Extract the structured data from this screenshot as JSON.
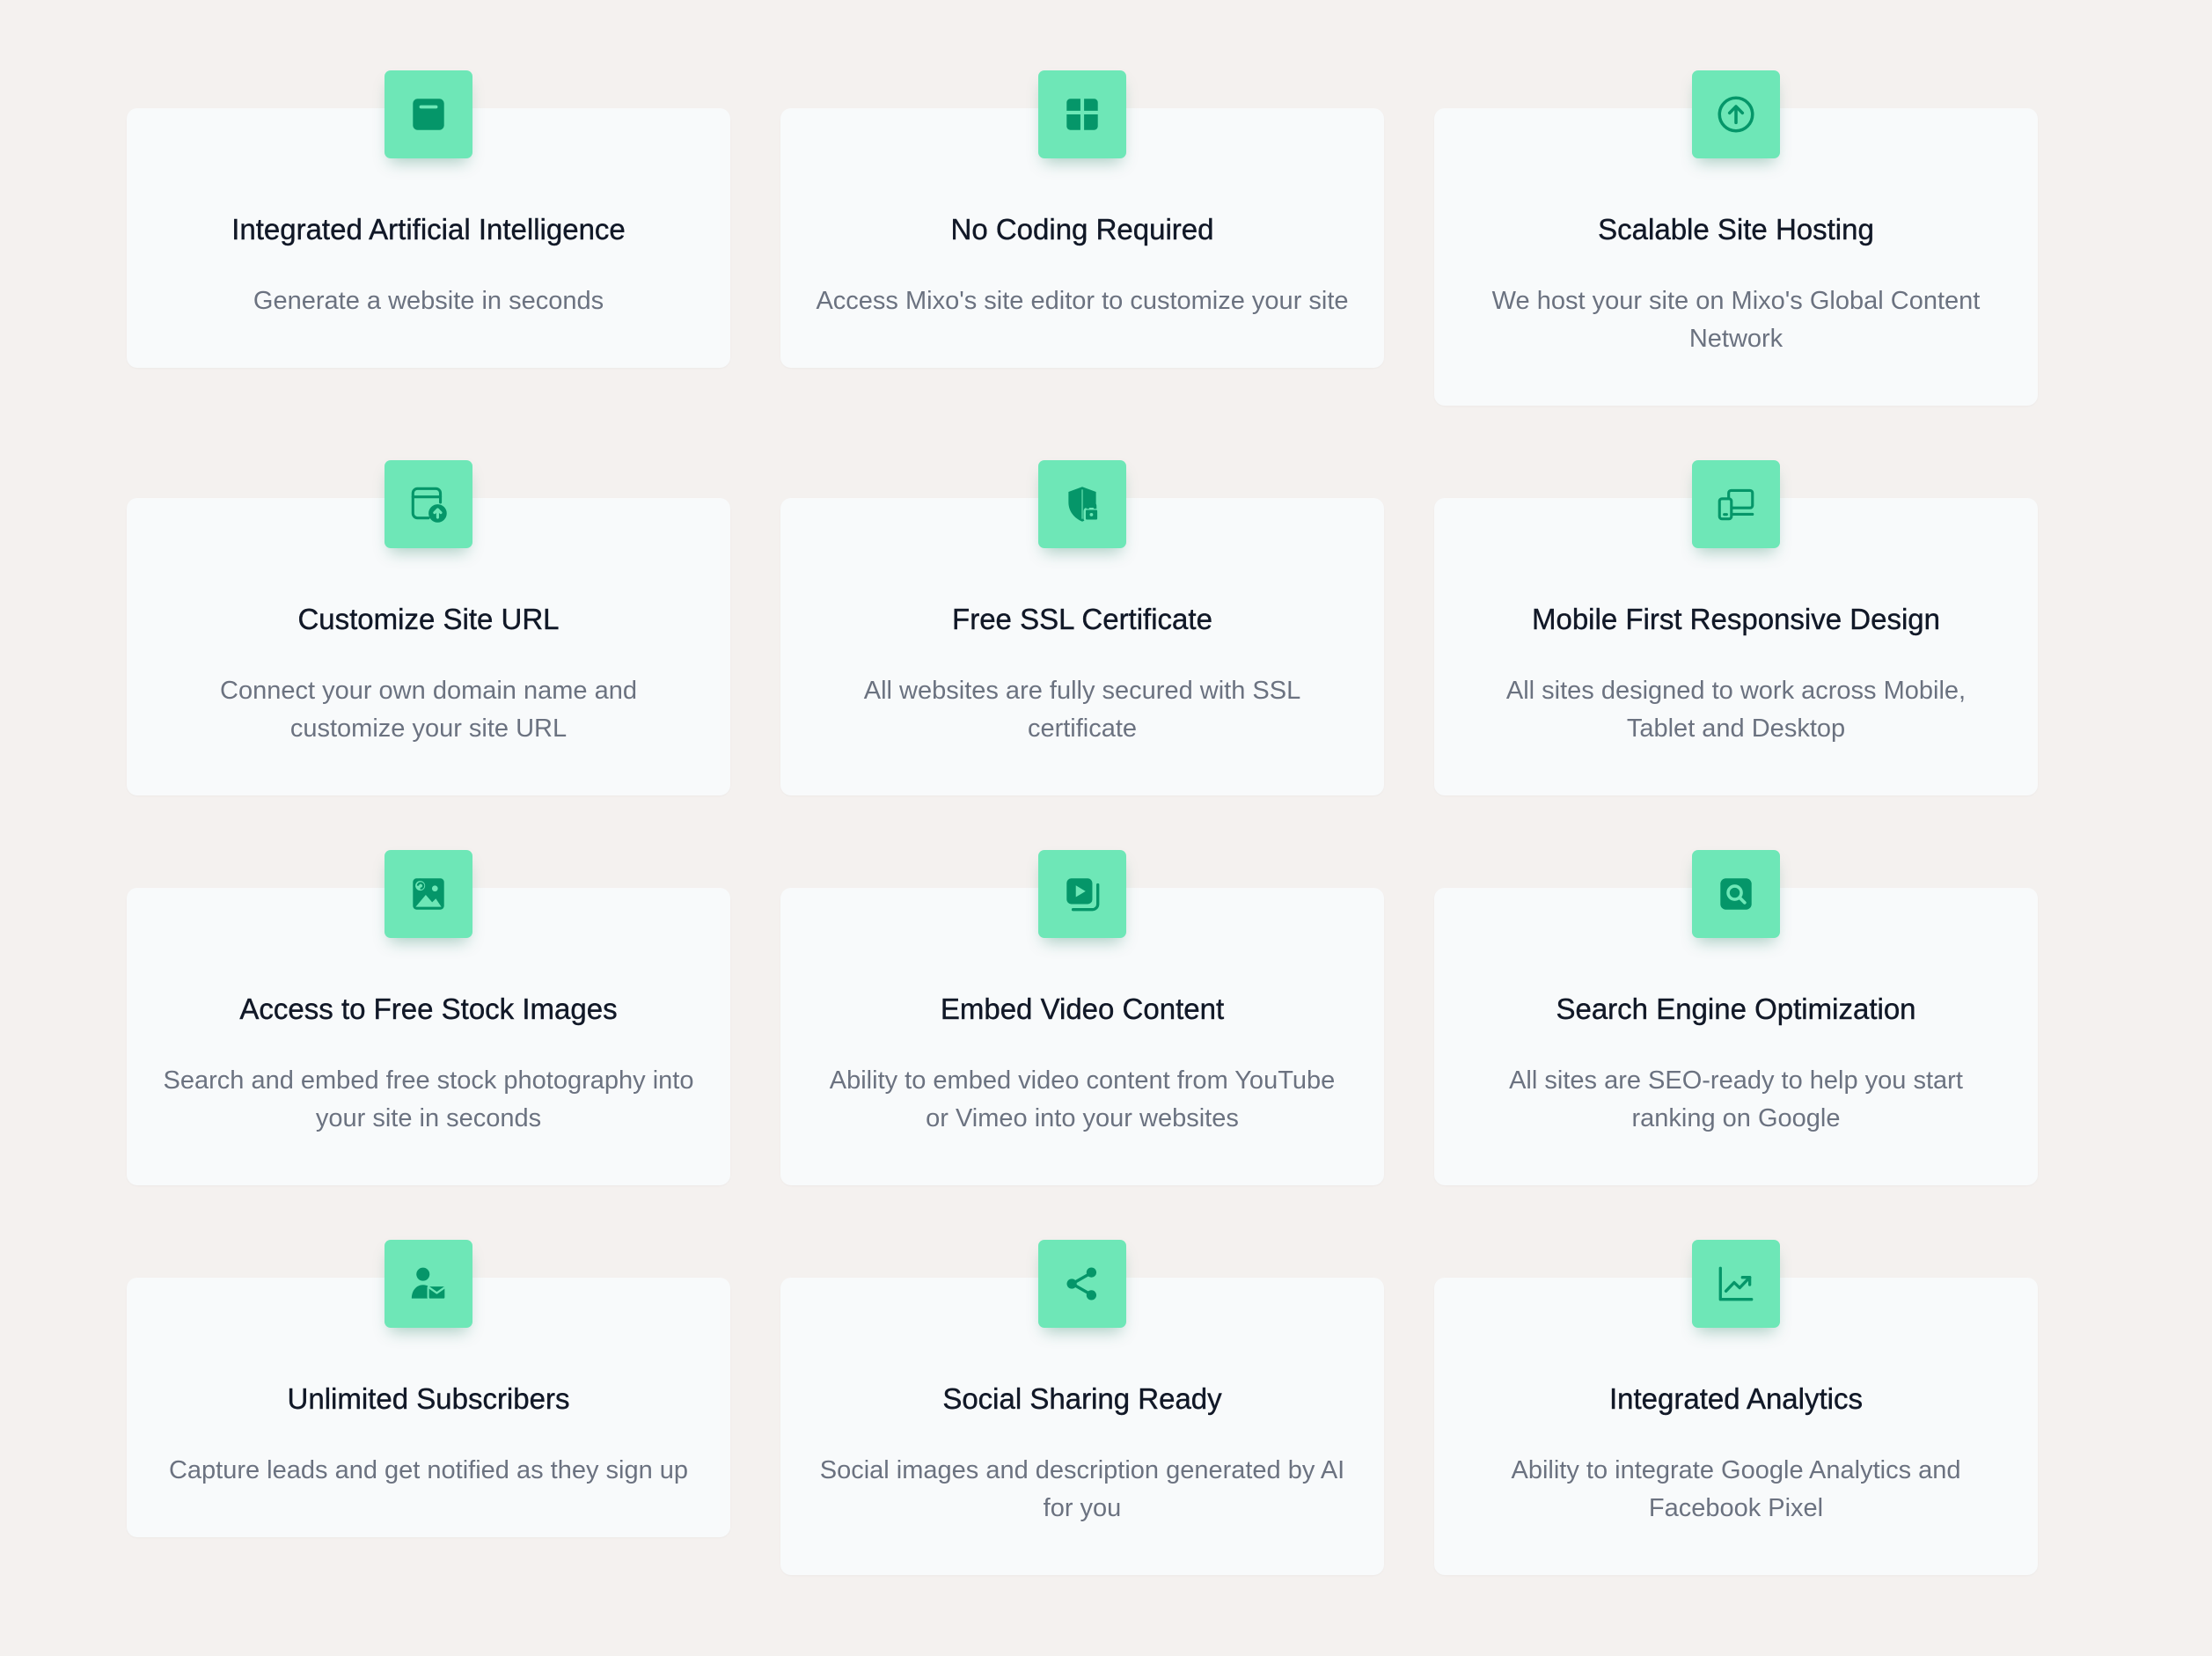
{
  "colors": {
    "page_background": "#f4f1ef",
    "card_background": "#f8fafb",
    "icon_badge": "#6ee7b7",
    "icon_foreground": "#059669",
    "title_text": "#111827",
    "description_text": "#6b7280"
  },
  "features": [
    {
      "icon": "browser-window-icon",
      "title": "Integrated Artificial Intelligence",
      "description": "Generate a website in seconds"
    },
    {
      "icon": "layout-grid-icon",
      "title": "No Coding Required",
      "description": "Access Mixo's site editor to customize your site"
    },
    {
      "icon": "arrow-up-circle-icon",
      "title": "Scalable Site Hosting",
      "description": "We host your site on Mixo's Global Content Network"
    },
    {
      "icon": "browser-upload-icon",
      "title": "Customize Site URL",
      "description": "Connect your own domain name and customize your site URL"
    },
    {
      "icon": "shield-lock-icon",
      "title": "Free SSL Certificate",
      "description": "All websites are fully secured with SSL certificate"
    },
    {
      "icon": "devices-icon",
      "title": "Mobile First Responsive Design",
      "description": "All sites designed to work across Mobile, Tablet and Desktop"
    },
    {
      "icon": "image-icon",
      "title": "Access to Free Stock Images",
      "description": "Search and embed free stock photography into your site in seconds"
    },
    {
      "icon": "video-play-icon",
      "title": "Embed Video Content",
      "description": "Ability to embed video content from YouTube or Vimeo into your websites"
    },
    {
      "icon": "search-icon",
      "title": "Search Engine Optimization",
      "description": "All sites are SEO-ready to help you start ranking on Google"
    },
    {
      "icon": "user-mail-icon",
      "title": "Unlimited Subscribers",
      "description": "Capture leads and get notified as they sign up"
    },
    {
      "icon": "share-icon",
      "title": "Social Sharing Ready",
      "description": "Social images and description generated by AI for you"
    },
    {
      "icon": "trending-chart-icon",
      "title": "Integrated Analytics",
      "description": "Ability to integrate Google Analytics and Facebook Pixel"
    }
  ]
}
